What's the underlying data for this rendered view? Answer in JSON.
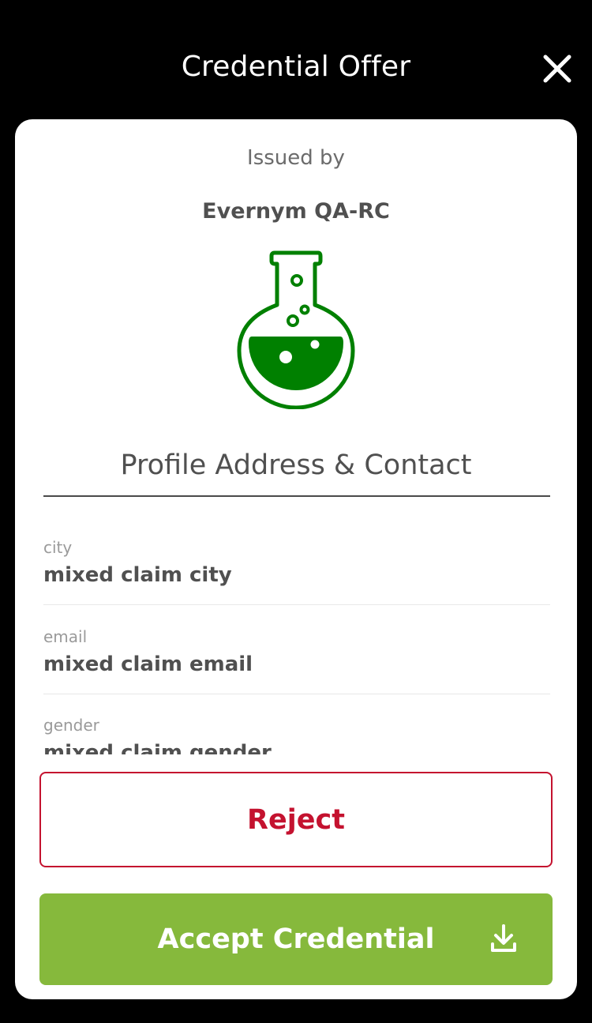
{
  "header": {
    "title": "Credential Offer",
    "close_icon": "close-icon"
  },
  "issuer": {
    "issued_by_label": "Issued by",
    "name": "Evernym QA-RC",
    "logo_icon": "flask-icon",
    "logo_color": "#008000"
  },
  "credential": {
    "title": "Profile Address & Contact",
    "attributes": [
      {
        "label": "city",
        "value": "mixed claim city"
      },
      {
        "label": "email",
        "value": "mixed claim email"
      },
      {
        "label": "gender",
        "value": "mixed claim gender"
      }
    ]
  },
  "actions": {
    "reject_label": "Reject",
    "accept_label": "Accept Credential",
    "accept_icon": "download-icon",
    "reject_color": "#c4122f",
    "accept_color": "#86b93c"
  }
}
